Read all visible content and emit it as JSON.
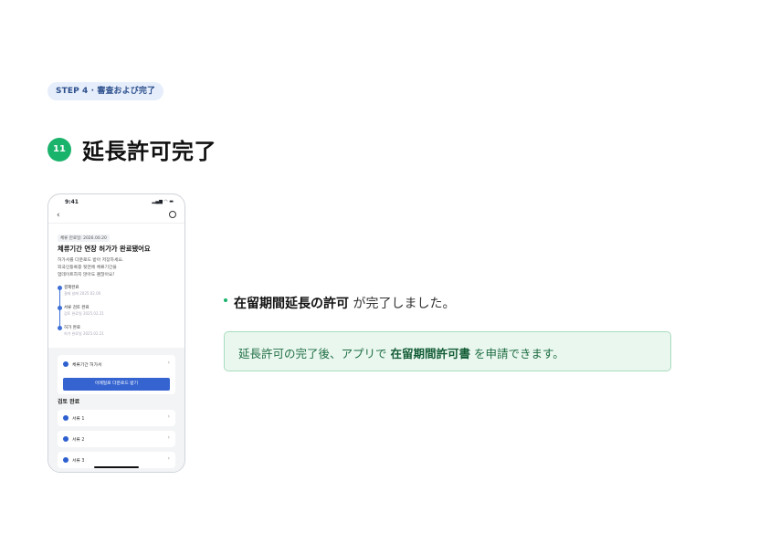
{
  "step": {
    "label": "STEP 4 · 審査および完了"
  },
  "heading": {
    "number": "11",
    "title": "延長許可完了"
  },
  "phone": {
    "time": "9:41",
    "status_icons": "signal-wifi-battery",
    "nav": {
      "back_icon": "chevron-left",
      "help_icon": "headset"
    },
    "tag": "체류 만료일: 2026.00.20",
    "title": "체류기간 연장 허가가 완료됐어요",
    "description": [
      "허가서를 다운로드 받아 저장하세요.",
      "외국인등록증 뒷면에 체류기간을",
      "업데이트하지 않아도 괜찮아요!"
    ],
    "timeline": [
      {
        "name": "결제완료",
        "date": "결제 날짜 2025.02.00"
      },
      {
        "name": "서류 검토 완료",
        "date": "검토 완료일 2025.02.21"
      },
      {
        "name": "허가 완료",
        "date": "허가 완료일 2025.02.21"
      }
    ],
    "permit_card": {
      "label": "체류기간 허가서",
      "button": "이메일로 다운로드 받기"
    },
    "review_heading": "검토 완료",
    "documents": [
      "서류 1",
      "서류 2",
      "서류 3"
    ]
  },
  "bullet": {
    "bold": "在留期間延長の許可",
    "rest": " が完了しました。"
  },
  "info": {
    "prefix": "延長許可の完了後、アプリで ",
    "bold": "在留期間許可書",
    "suffix": " を申請できます。"
  },
  "colors": {
    "accent_green": "#1ab36b",
    "primary_blue": "#3564d1",
    "info_bg": "#eaf7ef"
  }
}
